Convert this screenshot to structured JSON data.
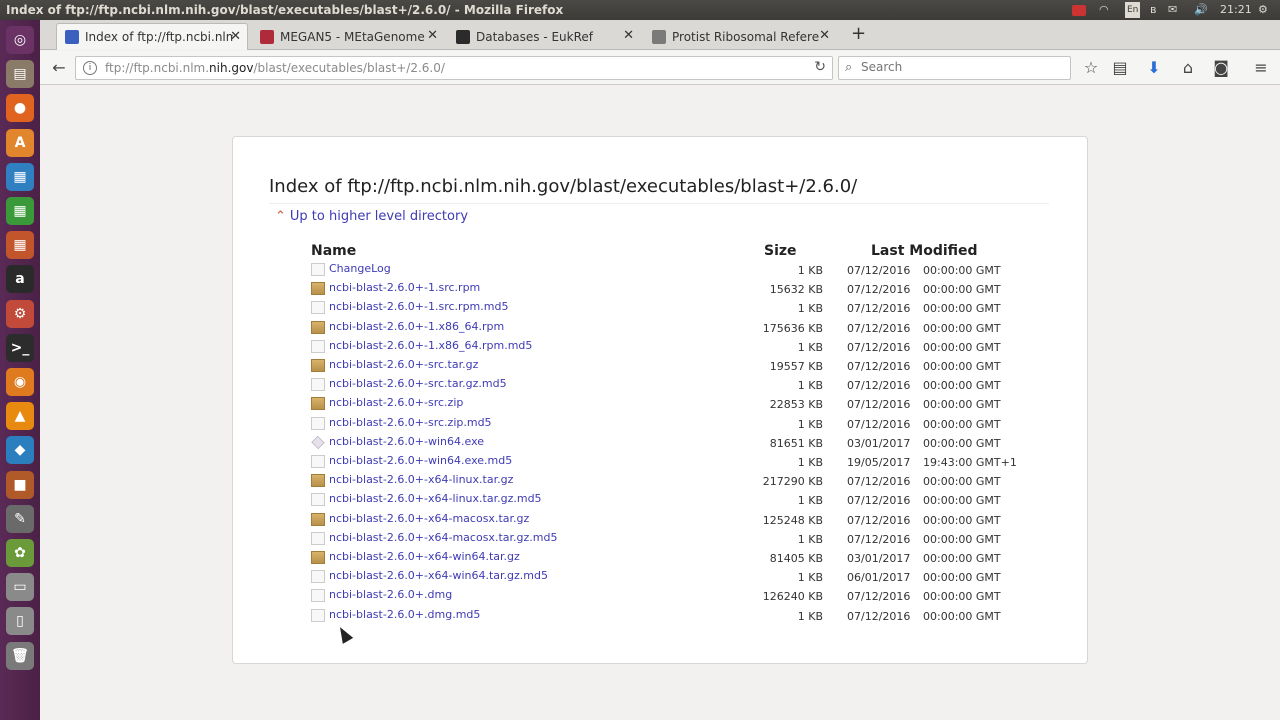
{
  "window": {
    "title": "Index of ftp://ftp.ncbi.nlm.nih.gov/blast/executables/blast+/2.6.0/ - Mozilla Firefox",
    "clock": "21:21",
    "tray_lang": "En"
  },
  "tabs": [
    {
      "label": "Index of ftp://ftp.ncbi.nlm",
      "color": "#3a5fbf"
    },
    {
      "label": "MEGAN5 - MEtaGenome A",
      "color": "#b02b3a"
    },
    {
      "label": "Databases - EukRef",
      "color": "#2b2b2b"
    },
    {
      "label": "Protist Ribosomal Refere",
      "color": "#7a7a7a"
    }
  ],
  "nav": {
    "url_prefix": "ftp://ftp.ncbi.nlm.",
    "url_domain": "nih.gov",
    "url_path": "/blast/executables/blast+/2.6.0/",
    "search_placeholder": "Search"
  },
  "page": {
    "heading": "Index of ftp://ftp.ncbi.nlm.nih.gov/blast/executables/blast+/2.6.0/",
    "up_link": "Up to higher level directory",
    "col_name": "Name",
    "col_size": "Size",
    "col_modified": "Last Modified"
  },
  "files": [
    {
      "name": "ChangeLog",
      "type": "file",
      "size": "1 KB",
      "date": "07/12/2016",
      "time": "00:00:00 GMT"
    },
    {
      "name": "ncbi-blast-2.6.0+-1.src.rpm",
      "type": "pkg",
      "size": "15632 KB",
      "date": "07/12/2016",
      "time": "00:00:00 GMT"
    },
    {
      "name": "ncbi-blast-2.6.0+-1.src.rpm.md5",
      "type": "file",
      "size": "1 KB",
      "date": "07/12/2016",
      "time": "00:00:00 GMT"
    },
    {
      "name": "ncbi-blast-2.6.0+-1.x86_64.rpm",
      "type": "pkg",
      "size": "175636 KB",
      "date": "07/12/2016",
      "time": "00:00:00 GMT"
    },
    {
      "name": "ncbi-blast-2.6.0+-1.x86_64.rpm.md5",
      "type": "file",
      "size": "1 KB",
      "date": "07/12/2016",
      "time": "00:00:00 GMT"
    },
    {
      "name": "ncbi-blast-2.6.0+-src.tar.gz",
      "type": "pkg",
      "size": "19557 KB",
      "date": "07/12/2016",
      "time": "00:00:00 GMT"
    },
    {
      "name": "ncbi-blast-2.6.0+-src.tar.gz.md5",
      "type": "file",
      "size": "1 KB",
      "date": "07/12/2016",
      "time": "00:00:00 GMT"
    },
    {
      "name": "ncbi-blast-2.6.0+-src.zip",
      "type": "pkg",
      "size": "22853 KB",
      "date": "07/12/2016",
      "time": "00:00:00 GMT"
    },
    {
      "name": "ncbi-blast-2.6.0+-src.zip.md5",
      "type": "file",
      "size": "1 KB",
      "date": "07/12/2016",
      "time": "00:00:00 GMT"
    },
    {
      "name": "ncbi-blast-2.6.0+-win64.exe",
      "type": "exe",
      "size": "81651 KB",
      "date": "03/01/2017",
      "time": "00:00:00 GMT"
    },
    {
      "name": "ncbi-blast-2.6.0+-win64.exe.md5",
      "type": "file",
      "size": "1 KB",
      "date": "19/05/2017",
      "time": "19:43:00 GMT+1"
    },
    {
      "name": "ncbi-blast-2.6.0+-x64-linux.tar.gz",
      "type": "pkg",
      "size": "217290 KB",
      "date": "07/12/2016",
      "time": "00:00:00 GMT"
    },
    {
      "name": "ncbi-blast-2.6.0+-x64-linux.tar.gz.md5",
      "type": "file",
      "size": "1 KB",
      "date": "07/12/2016",
      "time": "00:00:00 GMT"
    },
    {
      "name": "ncbi-blast-2.6.0+-x64-macosx.tar.gz",
      "type": "pkg",
      "size": "125248 KB",
      "date": "07/12/2016",
      "time": "00:00:00 GMT"
    },
    {
      "name": "ncbi-blast-2.6.0+-x64-macosx.tar.gz.md5",
      "type": "file",
      "size": "1 KB",
      "date": "07/12/2016",
      "time": "00:00:00 GMT"
    },
    {
      "name": "ncbi-blast-2.6.0+-x64-win64.tar.gz",
      "type": "pkg",
      "size": "81405 KB",
      "date": "03/01/2017",
      "time": "00:00:00 GMT"
    },
    {
      "name": "ncbi-blast-2.6.0+-x64-win64.tar.gz.md5",
      "type": "file",
      "size": "1 KB",
      "date": "06/01/2017",
      "time": "00:00:00 GMT"
    },
    {
      "name": "ncbi-blast-2.6.0+.dmg",
      "type": "file",
      "size": "126240 KB",
      "date": "07/12/2016",
      "time": "00:00:00 GMT"
    },
    {
      "name": "ncbi-blast-2.6.0+.dmg.md5",
      "type": "file",
      "size": "1 KB",
      "date": "07/12/2016",
      "time": "00:00:00 GMT"
    }
  ],
  "launcher": [
    {
      "icon": "ubuntu-dash-icon",
      "color": "#6b3266",
      "glyph": "◎"
    },
    {
      "icon": "files-icon",
      "color": "#8a7a68",
      "glyph": "▤"
    },
    {
      "icon": "firefox-icon",
      "color": "#e0631f",
      "glyph": "●"
    },
    {
      "icon": "software-center-icon",
      "color": "#e2862e",
      "glyph": "A"
    },
    {
      "icon": "writer-icon",
      "color": "#2f7fc1",
      "glyph": "▦"
    },
    {
      "icon": "calc-icon",
      "color": "#3a9a3a",
      "glyph": "▦"
    },
    {
      "icon": "impress-icon",
      "color": "#c2552c",
      "glyph": "▦"
    },
    {
      "icon": "amazon-icon",
      "color": "#2a2a2a",
      "glyph": "a"
    },
    {
      "icon": "settings-icon",
      "color": "#c24a3a",
      "glyph": "⚙"
    },
    {
      "icon": "terminal-icon",
      "color": "#2c2c2c",
      "glyph": ">_"
    },
    {
      "icon": "blender-icon",
      "color": "#e07a1f",
      "glyph": "◉"
    },
    {
      "icon": "vlc-icon",
      "color": "#e88a10",
      "glyph": "▲"
    },
    {
      "icon": "kodi-icon",
      "color": "#2b7fbf",
      "glyph": "◆"
    },
    {
      "icon": "app-icon",
      "color": "#b05a2a",
      "glyph": "■"
    },
    {
      "icon": "text-editor-icon",
      "color": "#6a6a6a",
      "glyph": "✎"
    },
    {
      "icon": "game-icon",
      "color": "#6a9a3a",
      "glyph": "✿"
    },
    {
      "icon": "drive-icon",
      "color": "#8a8a8a",
      "glyph": "▭"
    },
    {
      "icon": "usb-icon",
      "color": "#8a8a8a",
      "glyph": "▯"
    },
    {
      "icon": "trash-icon",
      "color": "#7a7a7a",
      "glyph": "🗑"
    }
  ]
}
